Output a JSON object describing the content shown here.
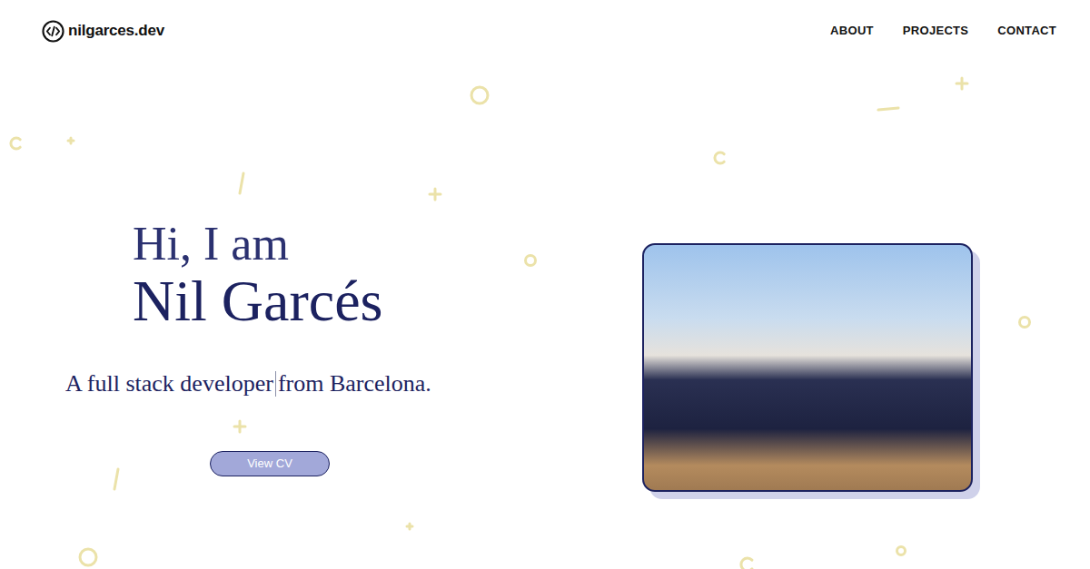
{
  "site": {
    "logo": "nilgarces.dev"
  },
  "nav": [
    {
      "label": "ABOUT"
    },
    {
      "label": "PROJECTS"
    },
    {
      "label": "CONTACT"
    }
  ],
  "hero": {
    "greeting": "Hi, I am",
    "name": "Nil Garcés",
    "tagline": [
      "A full stack developer",
      "from Barcelona."
    ],
    "button": "View CV"
  }
}
